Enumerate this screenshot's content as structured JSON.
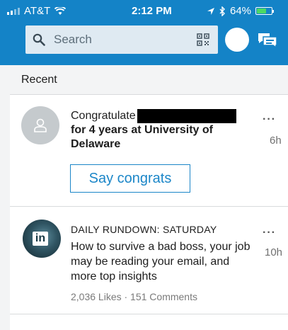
{
  "status_bar": {
    "carrier": "AT&T",
    "time": "2:12 PM",
    "battery_pct": "64%",
    "battery_level": 0.64,
    "accent": "#4cd964"
  },
  "header": {
    "search_placeholder": "Search",
    "icons": [
      "search-icon",
      "qr-code-icon",
      "profile-avatar",
      "messaging-icon"
    ],
    "background": "#1483c7"
  },
  "section": {
    "title": "Recent"
  },
  "feed": [
    {
      "line1": "Congratulate",
      "line2": "for 4 years at University of Delaware",
      "more": "···",
      "time": "6h",
      "button": "Say congrats"
    },
    {
      "kicker": "DAILY RUNDOWN: SATURDAY",
      "title": "How to survive a bad boss, your job may be reading your email, and more top insights",
      "social": "2,036 Likes · 151 Comments",
      "more": "···",
      "time": "10h",
      "logo": "in"
    }
  ]
}
